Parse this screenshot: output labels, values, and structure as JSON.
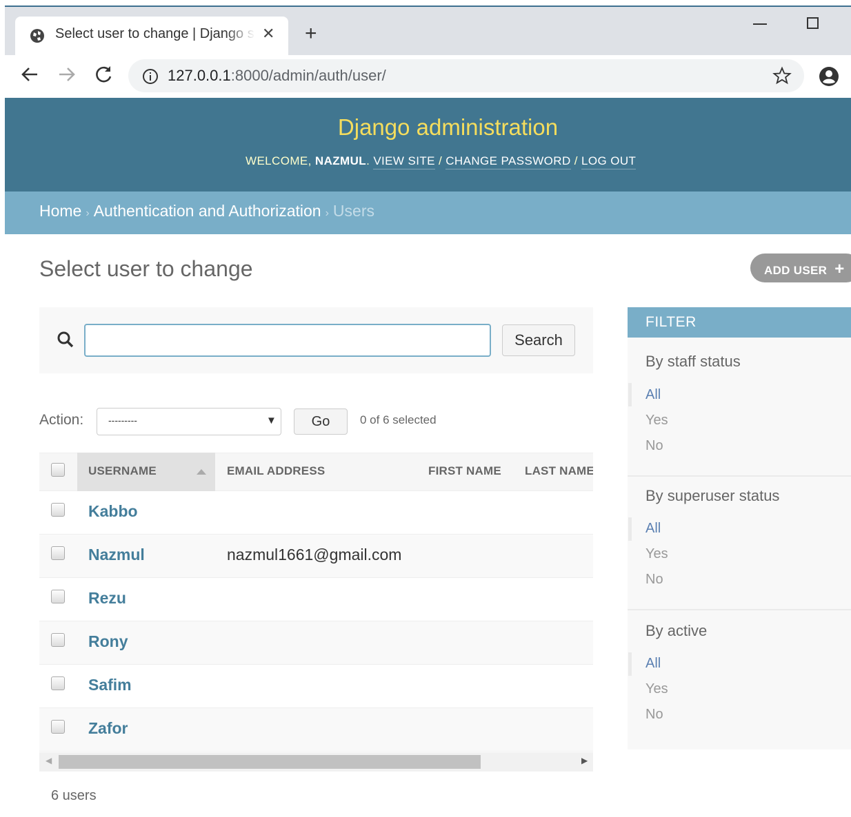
{
  "browser": {
    "tab_title": "Select user to change | Django site admin",
    "new_tab": "+",
    "url_host": "127.0.0.1",
    "url_rest": ":8000/admin/auth/user/"
  },
  "header": {
    "branding": "Django administration",
    "welcome": "WELCOME,",
    "username": "NAZMUL",
    "view_site": "VIEW SITE",
    "change_password": "CHANGE PASSWORD",
    "log_out": "LOG OUT",
    "sep": "/"
  },
  "breadcrumbs": {
    "home": "Home",
    "app": "Authentication and Authorization",
    "current": "Users",
    "sep": "›"
  },
  "page": {
    "title": "Select user to change",
    "add_button": "ADD USER",
    "add_icon": "+"
  },
  "search": {
    "value": "",
    "button": "Search"
  },
  "actions": {
    "label": "Action:",
    "selected_option": "---------",
    "go": "Go",
    "counter": "0 of 6 selected"
  },
  "table": {
    "columns": [
      "USERNAME",
      "EMAIL ADDRESS",
      "FIRST NAME",
      "LAST NAME"
    ],
    "rows": [
      {
        "username": "Kabbo",
        "email": ""
      },
      {
        "username": "Nazmul",
        "email": "nazmul1661@gmail.com"
      },
      {
        "username": "Rezu",
        "email": ""
      },
      {
        "username": "Rony",
        "email": ""
      },
      {
        "username": "Safim",
        "email": ""
      },
      {
        "username": "Zafor",
        "email": ""
      }
    ]
  },
  "paginator": "6 users",
  "filter": {
    "title": "FILTER",
    "groups": [
      {
        "title": "By staff status",
        "options": [
          "All",
          "Yes",
          "No"
        ]
      },
      {
        "title": "By superuser status",
        "options": [
          "All",
          "Yes",
          "No"
        ]
      },
      {
        "title": "By active",
        "options": [
          "All",
          "Yes",
          "No"
        ]
      }
    ]
  },
  "colors": {
    "header_bg": "#417690",
    "branding": "#f5dd5d",
    "breadcrumbs_bg": "#79aec8",
    "link": "#447e9b"
  }
}
